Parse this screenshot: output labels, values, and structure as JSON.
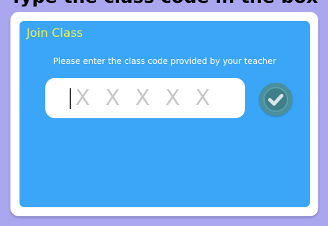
{
  "page": {
    "banner_text": "Type the class code in the box"
  },
  "dialog": {
    "title": "Join Class",
    "instruction": "Please enter the class code provided by your teacher",
    "code_input": {
      "value": "",
      "placeholder": "X X X X X"
    },
    "submit_icon": "checkmark-icon"
  },
  "colors": {
    "background": "#aaa7ef",
    "panel": "#3ba5f8",
    "title": "#f2f24a",
    "submit_button": "#4a8f9c"
  }
}
